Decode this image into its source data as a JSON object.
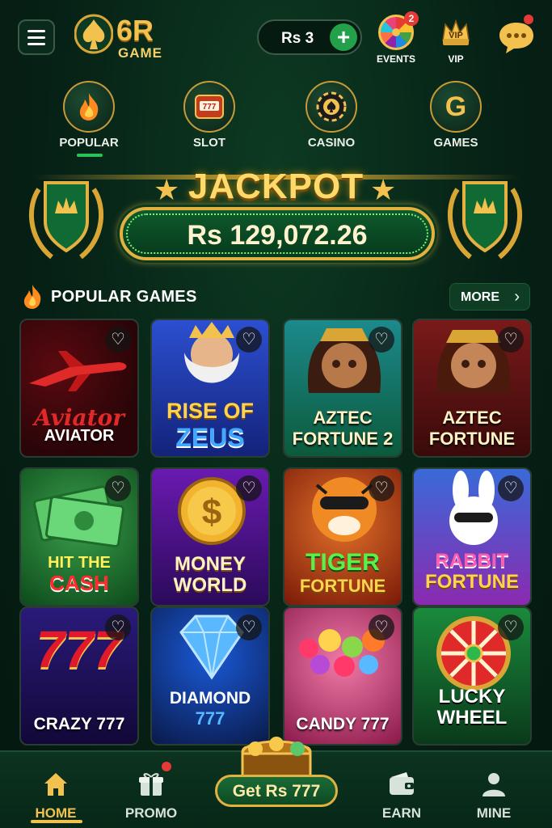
{
  "header": {
    "logo_main": "6R",
    "logo_sub": "GAME",
    "balance": "Rs 3",
    "plus": "+",
    "events_label": "EVENTS",
    "events_badge": "2",
    "vip_label": "VIP",
    "vip_crown_text": "VIP"
  },
  "tabs": [
    {
      "label": "POPULAR",
      "icon": "fire-icon",
      "active": true
    },
    {
      "label": "SLOT",
      "icon": "slot-machine-icon"
    },
    {
      "label": "CASINO",
      "icon": "poker-chip-icon"
    },
    {
      "label": "GAMES",
      "icon": "g-letter-icon",
      "glyph": "G"
    }
  ],
  "jackpot": {
    "title": "JACKPOT",
    "amount": "Rs 129,072.26"
  },
  "section": {
    "title": "POPULAR GAMES",
    "more": "MORE"
  },
  "games": [
    {
      "title": "AVIATOR",
      "art_text": "Aviator"
    },
    {
      "title": "RISE OF ZEUS",
      "line1": "RISE OF",
      "line2": "ZEUS"
    },
    {
      "title": "AZTEC FORTUNE 2",
      "line1": "AZTEC",
      "line2": "FORTUNE 2"
    },
    {
      "title": "AZTEC FORTUNE",
      "line1": "AZTEC",
      "line2": "FORTUNE"
    },
    {
      "title": "HIT THE CASH",
      "line1": "HIT THE",
      "line2": "CASH"
    },
    {
      "title": "MONEY WORLD",
      "line1": "MONEY",
      "line2": "WORLD"
    },
    {
      "title": "TIGER FORTUNE",
      "line1": "TIGER",
      "line2": "FORTUNE"
    },
    {
      "title": "RABBIT FORTUNE",
      "line1": "RABBIT",
      "line2": "FORTUNE"
    },
    {
      "title": "CRAZY 777",
      "art_text": "777"
    },
    {
      "title": "DIAMOND 777",
      "line1": "DIAMOND",
      "line2": "777"
    },
    {
      "title": "CANDY 777"
    },
    {
      "title": "LUCKY WHEEL",
      "line1": "LUCKY",
      "line2": "WHEEL"
    }
  ],
  "bottom_nav": {
    "home": "HOME",
    "promo": "PROMO",
    "center": "Get Rs 777",
    "earn": "EARN",
    "mine": "MINE"
  },
  "colors": {
    "background": "#062015",
    "accent_gold": "#f2c14e",
    "accent_green": "#28c257",
    "badge_red": "#e53935"
  }
}
